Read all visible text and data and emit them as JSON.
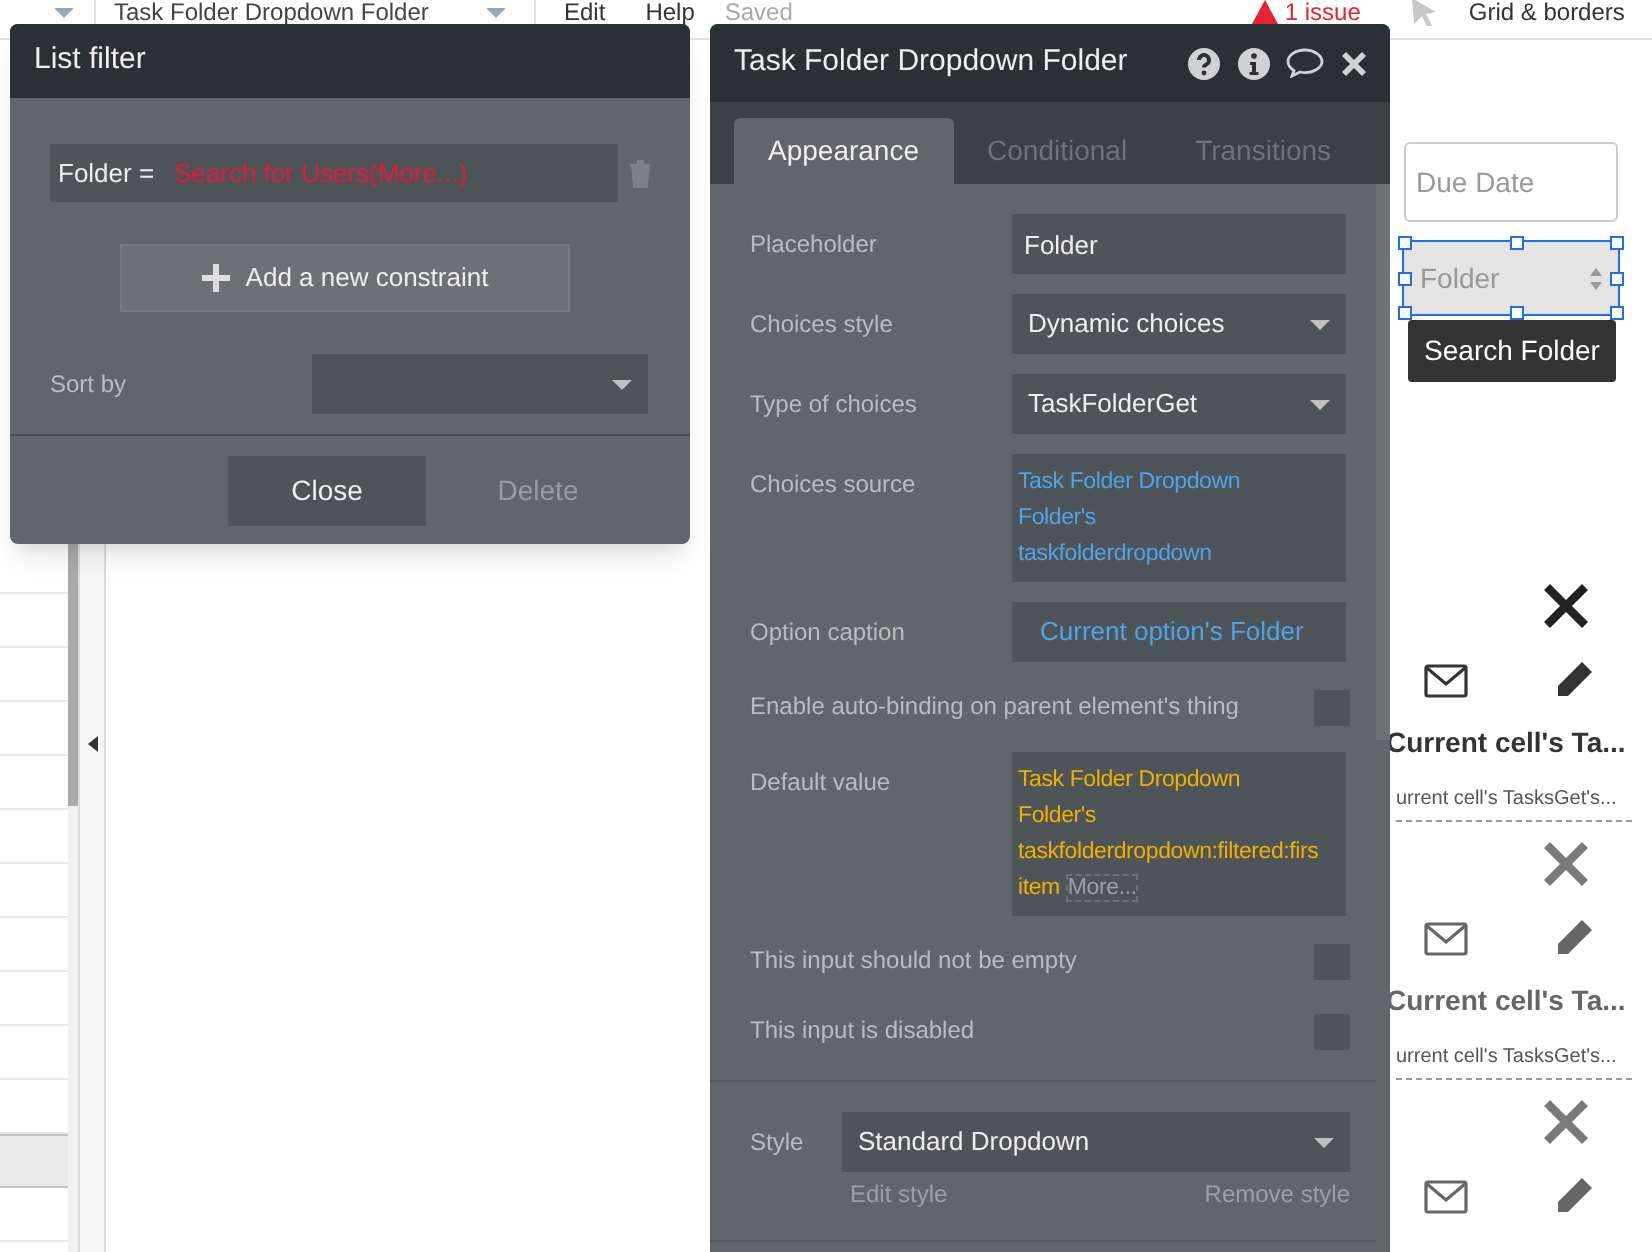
{
  "top_bar": {
    "element_selector": "Task Folder Dropdown Folder",
    "menu": [
      "Edit",
      "Help"
    ],
    "save_status": "Saved",
    "issues": "1 issue",
    "grid_toggle": "Grid & borders"
  },
  "sidebar": {
    "rows": [
      {
        "selected": false
      },
      {
        "selected": false
      },
      {
        "selected": false
      },
      {
        "selected": false
      },
      {
        "selected": false
      },
      {
        "selected": false
      },
      {
        "selected": false
      },
      {
        "selected": false
      },
      {
        "selected": false
      },
      {
        "selected": false
      },
      {
        "selected": false
      },
      {
        "selected": true
      },
      {
        "selected": false
      }
    ]
  },
  "list_filter": {
    "title": "List filter",
    "constraints": [
      {
        "field": "Folder =",
        "value": "Search for Users(More...)"
      }
    ],
    "add_button": "Add a new constraint",
    "sort_by": {
      "label": "Sort by"
    },
    "buttons": [
      {
        "label": "Close",
        "disabled": false
      },
      {
        "label": "Delete",
        "disabled": true
      }
    ]
  },
  "property_editor": {
    "title": "Task Folder Dropdown Folder",
    "tabs": [
      {
        "label": "Appearance",
        "selected": true
      },
      {
        "label": "Conditional",
        "selected": false
      },
      {
        "label": "Transitions",
        "selected": false
      }
    ],
    "rows": [
      {
        "kind": "input",
        "label": "Placeholder",
        "value": "Folder"
      },
      {
        "kind": "dropdown",
        "label": "Choices style",
        "value": "Dynamic choices"
      },
      {
        "kind": "dropdown",
        "label": "Type of choices",
        "value": "TaskFolderGet"
      },
      {
        "kind": "expression",
        "label": "Choices source",
        "lines": [
          "Task Folder Dropdown",
          "Folder's",
          "taskfolderdropdown"
        ],
        "color": "#4fa3e8"
      },
      {
        "kind": "caption",
        "label": "Option caption",
        "value": "Current option's Folder",
        "color": "#4fa3e8"
      },
      {
        "kind": "checkbox",
        "label": "Enable auto-binding on parent element's thing",
        "checked": false
      },
      {
        "kind": "expression",
        "label": "Default value",
        "lines": [
          "Task Folder Dropdown",
          "Folder's",
          "taskfolderdropdown:filtered:firs",
          "item"
        ],
        "more": "More...",
        "color": "#f0b000"
      },
      {
        "kind": "checkbox",
        "label": "This input should not be empty",
        "checked": false
      },
      {
        "kind": "checkbox",
        "label": "This input is disabled",
        "checked": false
      }
    ],
    "style": {
      "label": "Style",
      "value": "Standard Dropdown",
      "edit": "Edit style",
      "remove": "Remove style"
    }
  },
  "canvas": {
    "due_date": {
      "placeholder": "Due Date"
    },
    "folder_dropdown": {
      "placeholder": "Folder",
      "selected": true
    },
    "search_button": "Search Folder",
    "cells": [
      {
        "title": "Current cell's Ta...",
        "subtitle": "urrent cell's TasksGet's...",
        "highlighted": true
      },
      {
        "title": "Current cell's Ta...",
        "subtitle": "urrent cell's TasksGet's...",
        "highlighted": false
      },
      {
        "highlighted": false
      }
    ]
  }
}
